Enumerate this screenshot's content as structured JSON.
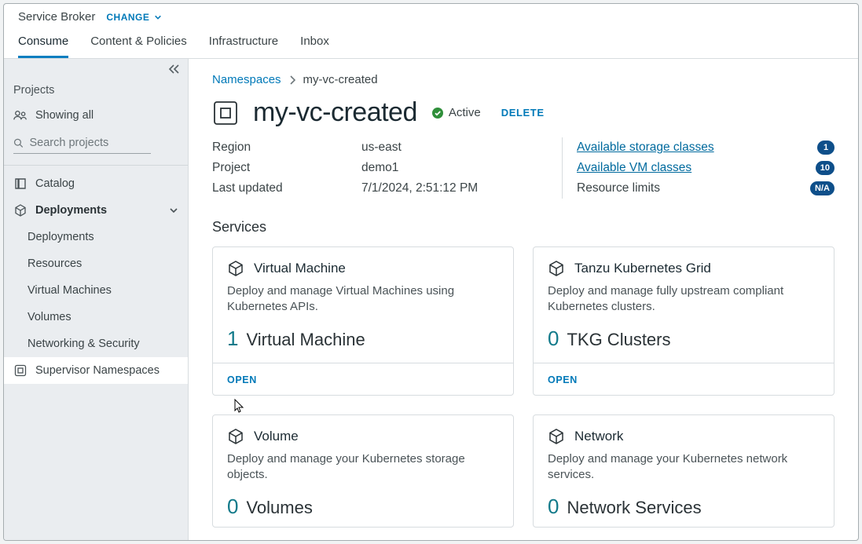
{
  "header": {
    "app_title": "Service Broker",
    "change_label": "CHANGE",
    "tabs": [
      {
        "label": "Consume",
        "active": true
      },
      {
        "label": "Content & Policies",
        "active": false
      },
      {
        "label": "Infrastructure",
        "active": false
      },
      {
        "label": "Inbox",
        "active": false
      }
    ]
  },
  "sidebar": {
    "projects_label": "Projects",
    "showing_all_label": "Showing all",
    "search_placeholder": "Search projects",
    "items": [
      {
        "key": "catalog",
        "label": "Catalog"
      },
      {
        "key": "deployments",
        "label": "Deployments",
        "group": true,
        "expanded": true,
        "children": [
          {
            "key": "deployments-all",
            "label": "Deployments"
          },
          {
            "key": "resources",
            "label": "Resources"
          },
          {
            "key": "vms",
            "label": "Virtual Machines"
          },
          {
            "key": "volumes",
            "label": "Volumes"
          },
          {
            "key": "netsec",
            "label": "Networking & Security"
          }
        ]
      },
      {
        "key": "sup-ns",
        "label": "Supervisor Namespaces",
        "selected": true
      }
    ]
  },
  "main": {
    "breadcrumb": {
      "root": "Namespaces",
      "current": "my-vc-created"
    },
    "title": "my-vc-created",
    "status": "Active",
    "delete_label": "DELETE",
    "meta_left": [
      {
        "k": "Region",
        "v": "us-east"
      },
      {
        "k": "Project",
        "v": "demo1"
      },
      {
        "k": "Last updated",
        "v": "7/1/2024, 2:51:12 PM"
      }
    ],
    "meta_right": [
      {
        "label": "Available storage classes",
        "link": true,
        "badge": "1"
      },
      {
        "label": "Available VM classes",
        "link": true,
        "badge": "10"
      },
      {
        "label": "Resource limits",
        "link": false,
        "badge": "N/A"
      }
    ],
    "services_heading": "Services",
    "open_label": "OPEN",
    "cards": [
      {
        "key": "vm",
        "title": "Virtual Machine",
        "desc": "Deploy and manage Virtual Machines using Kubernetes APIs.",
        "count_num": "1",
        "count_label": "Virtual Machine",
        "footer": true
      },
      {
        "key": "tkg",
        "title": "Tanzu Kubernetes Grid",
        "desc": "Deploy and manage fully upstream compliant Kubernetes clusters.",
        "count_num": "0",
        "count_label": "TKG Clusters",
        "footer": true
      },
      {
        "key": "vol",
        "title": "Volume",
        "desc": "Deploy and manage your Kubernetes storage objects.",
        "count_num": "0",
        "count_label": "Volumes",
        "footer": false
      },
      {
        "key": "net",
        "title": "Network",
        "desc": "Deploy and manage your Kubernetes network services.",
        "count_num": "0",
        "count_label": "Network Services",
        "footer": false
      }
    ]
  }
}
